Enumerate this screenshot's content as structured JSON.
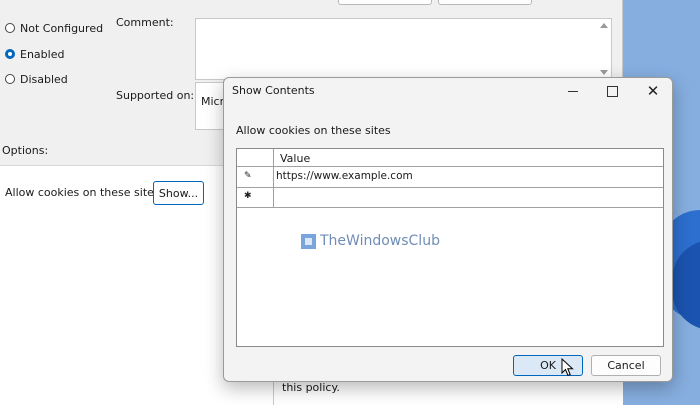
{
  "policy": {
    "radio_options": [
      {
        "label": "Not Configured",
        "checked": false
      },
      {
        "label": "Enabled",
        "checked": true
      },
      {
        "label": "Disabled",
        "checked": false
      }
    ],
    "comment_label": "Comment:",
    "supported_label": "Supported on:",
    "supported_value": "Micr",
    "options_label": "Options:",
    "option_item_label": "Allow cookies on these sites",
    "show_button_label": "Show...",
    "help_text_fragment": "this policy."
  },
  "dialog": {
    "title": "Show Contents",
    "list_label": "Allow cookies on these sites",
    "column_header": "Value",
    "rows": [
      {
        "icon": "edit-row-icon",
        "value": "https://www.example.com"
      },
      {
        "icon": "new-row-icon",
        "value": ""
      }
    ],
    "ok_label": "OK",
    "cancel_label": "Cancel"
  },
  "watermark": {
    "text": "TheWindowsClub"
  },
  "colors": {
    "accent": "#0067c0",
    "desktop": "#86aedf",
    "watermark": "#6f8db6"
  }
}
